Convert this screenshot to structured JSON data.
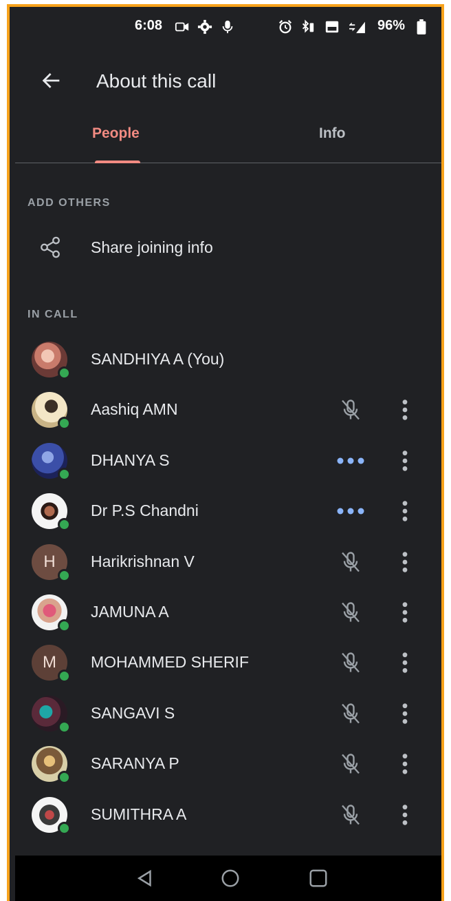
{
  "status_bar": {
    "time": "6:08",
    "battery": "96%"
  },
  "app_bar": {
    "title": "About this call",
    "back_icon": "arrow-left-icon"
  },
  "tabs": [
    {
      "label": "People",
      "selected": true
    },
    {
      "label": "Info",
      "selected": false
    }
  ],
  "add_others": {
    "heading": "ADD OTHERS",
    "share_label": "Share joining info",
    "share_icon": "share-icon"
  },
  "in_call": {
    "heading": "IN CALL",
    "participants": [
      {
        "name": "SANDHIYA A (You)",
        "avatar": "photo",
        "status": "none"
      },
      {
        "name": "Aashiq AMN",
        "avatar": "photo",
        "status": "muted"
      },
      {
        "name": "DHANYA S",
        "avatar": "photo",
        "status": "talking"
      },
      {
        "name": "Dr P.S Chandni",
        "avatar": "photo",
        "status": "talking"
      },
      {
        "name": "Harikrishnan V",
        "avatar": "letter",
        "initial": "H",
        "status": "muted"
      },
      {
        "name": "JAMUNA A",
        "avatar": "photo",
        "status": "muted"
      },
      {
        "name": "MOHAMMED SHERIF",
        "avatar": "letter",
        "initial": "M",
        "status": "muted"
      },
      {
        "name": "SANGAVI S",
        "avatar": "photo",
        "status": "muted"
      },
      {
        "name": "SARANYA P",
        "avatar": "photo",
        "status": "muted"
      },
      {
        "name": "SUMITHRA A",
        "avatar": "photo",
        "status": "muted"
      }
    ]
  },
  "colors": {
    "background": "#202124",
    "accent": "#f28b82",
    "talking": "#8ab4f8",
    "online": "#34a853",
    "frame": "#f7a21b"
  }
}
